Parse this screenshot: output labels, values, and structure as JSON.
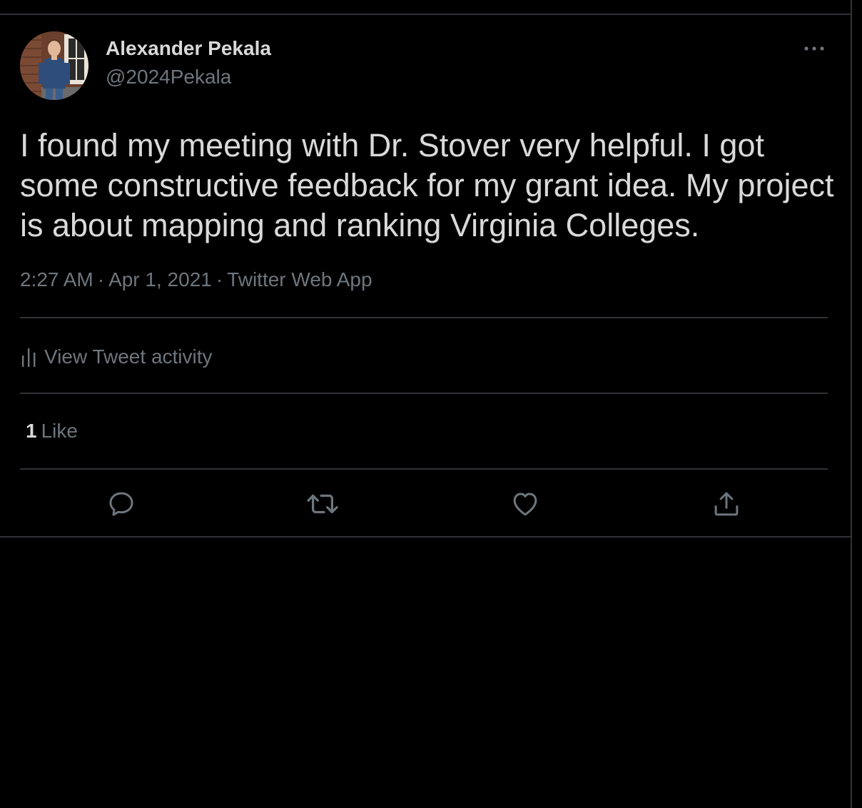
{
  "colors": {
    "background": "#000000",
    "primary_text": "#d9d9d9",
    "secondary_text": "#6e767d",
    "border": "#2f3336"
  },
  "tweet": {
    "author": {
      "name": "Alexander Pekala",
      "handle": "@2024Pekala",
      "avatar_icon": "profile-photo"
    },
    "text": "I found my meeting with Dr. Stover very helpful. I got some constructive feedback for my grant idea. My project is about mapping and ranking Virginia Colleges.",
    "meta": {
      "time": "2:27 AM",
      "separator": "·",
      "date": "Apr 1, 2021",
      "source": "Twitter Web App"
    },
    "activity": {
      "icon": "bar-chart-icon",
      "label": "View Tweet activity"
    },
    "stats": {
      "likes_count": "1",
      "likes_label": "Like"
    },
    "actions": [
      {
        "name": "reply",
        "icon": "reply-icon"
      },
      {
        "name": "retweet",
        "icon": "retweet-icon"
      },
      {
        "name": "like",
        "icon": "heart-icon"
      },
      {
        "name": "share",
        "icon": "share-icon"
      }
    ],
    "more_icon": "more-icon"
  }
}
